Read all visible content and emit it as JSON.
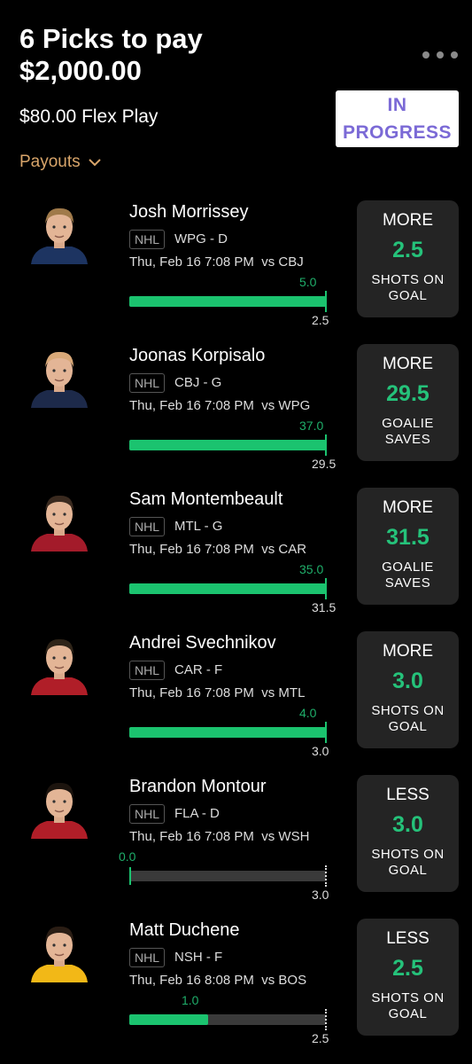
{
  "header": {
    "title_line1": "6 Picks to pay",
    "title_line2": "$2,000.00",
    "subtitle": "$80.00 Flex Play",
    "status_line1": "IN",
    "status_line2": "PROGRESS",
    "payouts_label": "Payouts"
  },
  "colors": {
    "accent_green": "#1bc36f",
    "status_purple": "#7b6ad6",
    "payouts_orange": "#d8a56a",
    "card_bg": "#242424"
  },
  "picks": [
    {
      "name": "Josh Morrissey",
      "league": "NHL",
      "team_pos": "WPG - D",
      "game": "Thu, Feb 16 7:08 PM  vs CBJ",
      "actual": "5.0",
      "line": "2.5",
      "progress": 1.0,
      "direction": "MORE",
      "stat_line1": "SHOTS ON",
      "stat_line2": "GOAL",
      "jersey": "#1d3461",
      "hair": "#a07a4a"
    },
    {
      "name": "Joonas Korpisalo",
      "league": "NHL",
      "team_pos": "CBJ - G",
      "game": "Thu, Feb 16 7:08 PM  vs WPG",
      "actual": "37.0",
      "line": "29.5",
      "progress": 1.0,
      "direction": "MORE",
      "stat_line1": "GOALIE",
      "stat_line2": "SAVES",
      "jersey": "#1d2a4a",
      "hair": "#d8a878"
    },
    {
      "name": "Sam Montembeault",
      "league": "NHL",
      "team_pos": "MTL - G",
      "game": "Thu, Feb 16 7:08 PM  vs CAR",
      "actual": "35.0",
      "line": "31.5",
      "progress": 1.0,
      "direction": "MORE",
      "stat_line1": "GOALIE",
      "stat_line2": "SAVES",
      "jersey": "#a31b2a",
      "hair": "#3a2a1f"
    },
    {
      "name": "Andrei Svechnikov",
      "league": "NHL",
      "team_pos": "CAR - F",
      "game": "Thu, Feb 16 7:08 PM  vs MTL",
      "actual": "4.0",
      "line": "3.0",
      "progress": 1.0,
      "direction": "MORE",
      "stat_line1": "SHOTS ON",
      "stat_line2": "GOAL",
      "jersey": "#b01e28",
      "hair": "#2f2418"
    },
    {
      "name": "Brandon Montour",
      "league": "NHL",
      "team_pos": "FLA - D",
      "game": "Thu, Feb 16 7:08 PM  vs WSH",
      "actual": "0.0",
      "line": "3.0",
      "progress": 0.0,
      "direction": "LESS",
      "stat_line1": "SHOTS ON",
      "stat_line2": "GOAL",
      "jersey": "#b01e28",
      "hair": "#1c140e"
    },
    {
      "name": "Matt Duchene",
      "league": "NHL",
      "team_pos": "NSH - F",
      "game": "Thu, Feb 16 8:08 PM  vs BOS",
      "actual": "1.0",
      "line": "2.5",
      "progress": 0.4,
      "direction": "LESS",
      "stat_line1": "SHOTS ON",
      "stat_line2": "GOAL",
      "jersey": "#f2b817",
      "hair": "#2a1d14"
    }
  ]
}
